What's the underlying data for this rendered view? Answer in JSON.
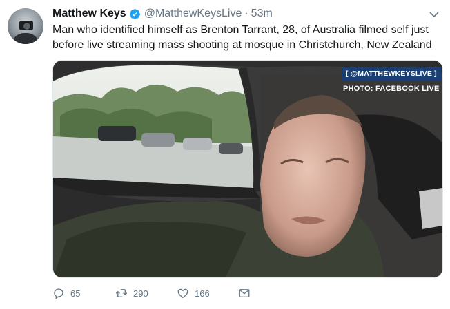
{
  "tweet": {
    "display_name": "Matthew Keys",
    "handle": "@MatthewKeysLive",
    "separator": "·",
    "time": "53m",
    "text": "Man who identified himself as Brenton Tarrant, 28, of Australia filmed self just before live streaming mass shooting at mosque in Christchurch, New Zealand",
    "media": {
      "overlay_tag": "[ @MATTHEWKEYSLIVE ]",
      "overlay_credit": "PHOTO: FACEBOOK LIVE"
    },
    "actions": {
      "reply_count": "65",
      "retweet_count": "290",
      "like_count": "166"
    },
    "icons": {
      "verified": "verified-badge-icon",
      "menu": "chevron-down-icon",
      "reply": "reply-icon",
      "retweet": "retweet-icon",
      "like": "heart-icon",
      "dm": "envelope-icon"
    },
    "colors": {
      "verified_blue": "#1da1f2",
      "muted_gray": "#657786",
      "text": "#14171a",
      "tag_bg": "#1b3f73"
    }
  }
}
